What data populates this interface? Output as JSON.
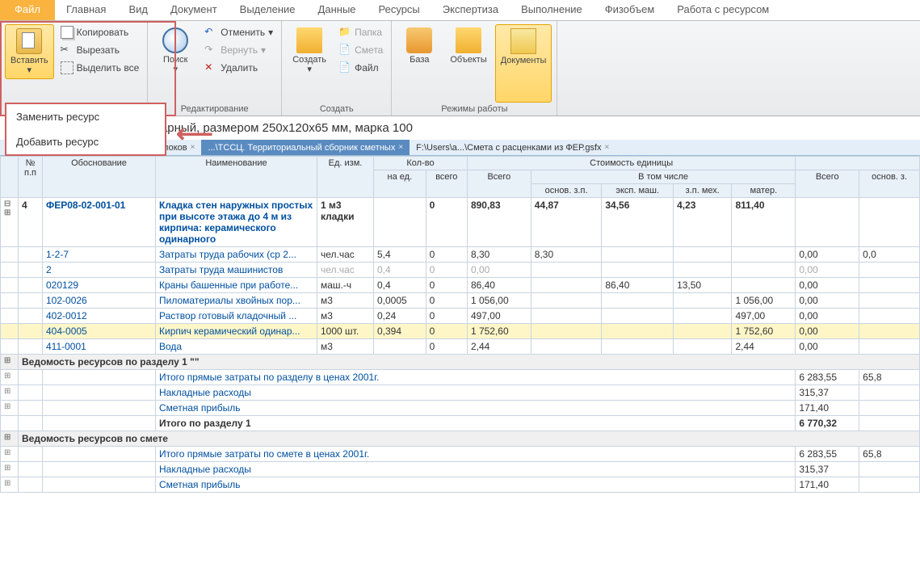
{
  "tabs": {
    "file": "Файл",
    "main": "Главная",
    "view": "Вид",
    "document": "Документ",
    "selection": "Выделение",
    "data": "Данные",
    "resources": "Ресурсы",
    "expert": "Экспертиза",
    "exec": "Выполнение",
    "phys": "Физобъем",
    "work": "Работа с ресурсом"
  },
  "ribbon": {
    "paste": "Вставить",
    "copy": "Копировать",
    "cut": "Вырезать",
    "selectall": "Выделить все",
    "search": "Поиск",
    "undo": "Отменить",
    "redo": "Вернуть",
    "delete": "Удалить",
    "editgroup": "Редактирование",
    "create": "Создать",
    "folder": "Папка",
    "estimate": "Смета",
    "filebtn": "Файл",
    "creategroup": "Создать",
    "base": "База",
    "objects": "Объекты",
    "documents": "Документы",
    "modegroup": "Режимы работы"
  },
  "dropdown": {
    "replace": "Заменить ресурс",
    "add": "Добавить ресурс"
  },
  "title": "Кирпич керамический одинарный, размером 250х120х65 мм, марка 100",
  "doctabs": {
    "t1": "...\\ФЕР08. Конструкции из кирпича и блоков",
    "t2": "...\\ТССЦ. Территориальный сборник сметных",
    "t3": "F:\\Users\\a...\\Смета с расценками из ФЕР.gsfx"
  },
  "headers": {
    "no": "№\nп.п",
    "basis": "Обоснование",
    "name": "Наименование",
    "unit": "Ед. изм.",
    "qty": "Кол-во",
    "qtyper": "на ед.",
    "qtytot": "всего",
    "cost": "Стоимость единицы",
    "costtot": "Всего",
    "incl": "В том числе",
    "base": "основ. з.п.",
    "mach": "эксп. маш.",
    "mech": "з.п. мех.",
    "mat": "матер.",
    "total": "Всего",
    "base2": "основ. з."
  },
  "rows": [
    {
      "no": "4",
      "code": "ФЕР08-02-001-01",
      "name": "Кладка стен наружных простых при высоте этажа до 4 м из кирпича: керамического одинарного",
      "unit": "1 м3 кладки",
      "qp": "",
      "qt": "0",
      "tot": "890,83",
      "b": "44,87",
      "m": "34,56",
      "mx": "4,23",
      "mt": "811,40",
      "gt": "",
      "bold": true
    },
    {
      "code": "1-2-7",
      "name": "Затраты труда рабочих (ср 2...",
      "unit": "чел.час",
      "qp": "5,4",
      "qt": "0",
      "tot": "8,30",
      "b": "8,30",
      "m": "",
      "mx": "",
      "mt": "",
      "gt": "0,00",
      "g2": "0,0"
    },
    {
      "code": "2",
      "name": "Затраты труда машинистов",
      "unit": "чел.час",
      "qp": "0,4",
      "qt": "0",
      "tot": "0,00",
      "gt": "0,00",
      "gray": true
    },
    {
      "code": "020129",
      "name": "Краны башенные при работе...",
      "unit": "маш.-ч",
      "qp": "0,4",
      "qt": "0",
      "tot": "86,40",
      "m": "86,40",
      "mx": "13,50",
      "gt": "0,00"
    },
    {
      "code": "102-0026",
      "name": "Пиломатериалы хвойных пор...",
      "unit": "м3",
      "qp": "0,0005",
      "qt": "0",
      "tot": "1 056,00",
      "mt": "1 056,00",
      "gt": "0,00"
    },
    {
      "code": "402-0012",
      "name": "Раствор готовый кладочный ...",
      "unit": "м3",
      "qp": "0,24",
      "qt": "0",
      "tot": "497,00",
      "mt": "497,00",
      "gt": "0,00"
    },
    {
      "code": "404-0005",
      "name": "Кирпич керамический одинар...",
      "unit": "1000 шт.",
      "qp": "0,394",
      "qt": "0",
      "tot": "1 752,60",
      "mt": "1 752,60",
      "gt": "0,00",
      "sel": true
    },
    {
      "code": "411-0001",
      "name": "Вода",
      "unit": "м3",
      "qp": "",
      "qt": "0",
      "tot": "2,44",
      "mt": "2,44",
      "gt": "0,00"
    }
  ],
  "sections": {
    "s1": "Ведомость ресурсов по разделу 1 \"\"",
    "s2": "Ведомость ресурсов по смете",
    "l1": "Итого прямые затраты по разделу в ценах 2001г.",
    "v1": "6 283,55",
    "v1b": "65,8",
    "l2": "Накладные расходы",
    "v2": "315,37",
    "l3": "Сметная прибыль",
    "v3": "171,40",
    "l4": "Итого по разделу 1",
    "v4": "6 770,32",
    "l5": "Итого прямые затраты по смете в ценах 2001г.",
    "v5": "6 283,55",
    "v5b": "65,8",
    "l6": "Накладные расходы",
    "v6": "315,37",
    "l7": "Сметная прибыль",
    "v7": "171,40"
  }
}
